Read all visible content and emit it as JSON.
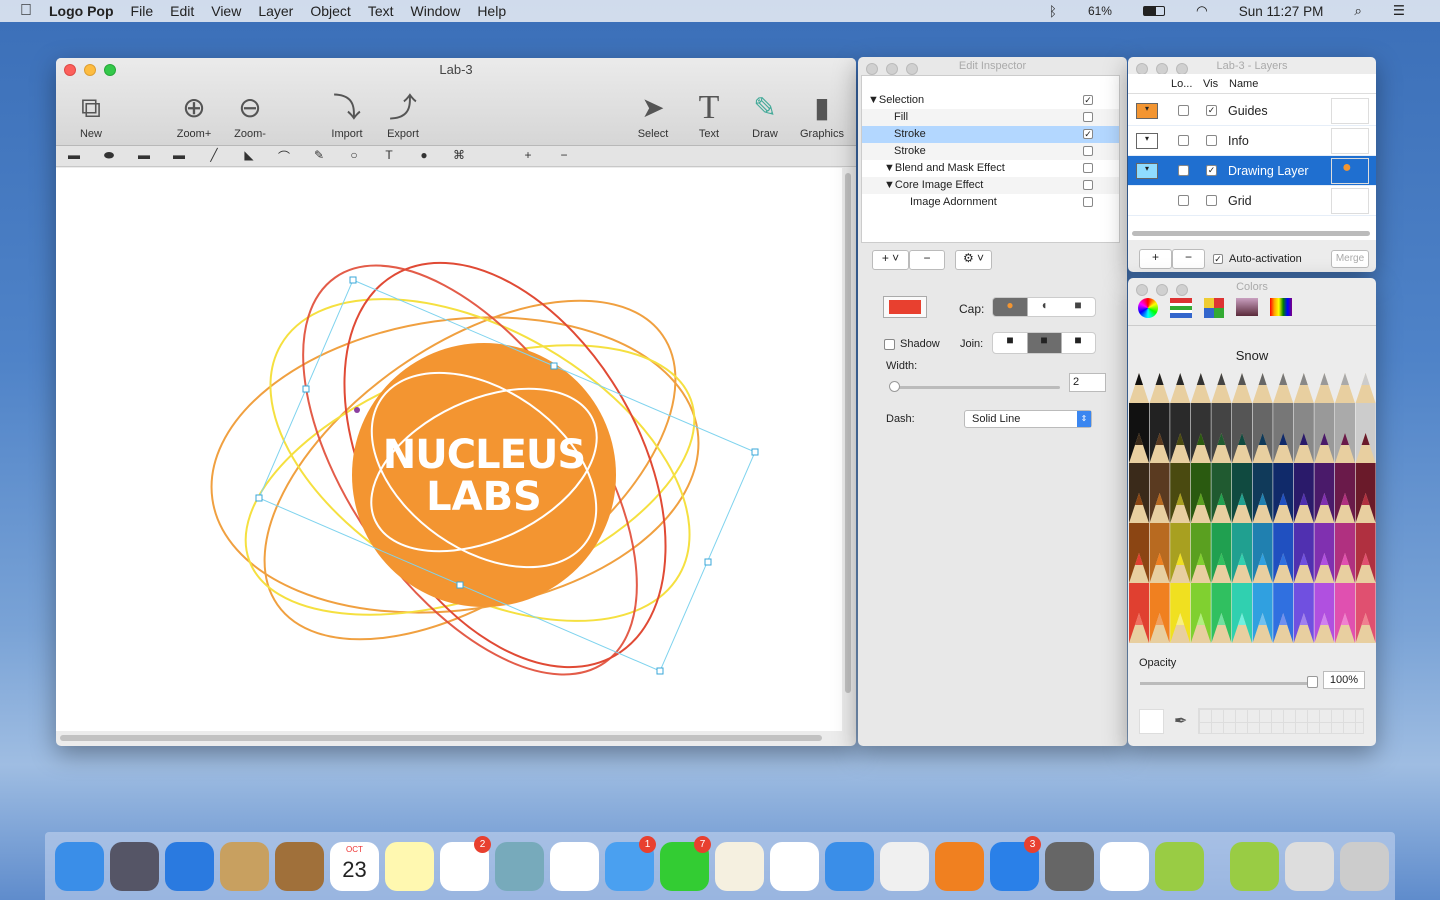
{
  "menubar": {
    "app": "Logo Pop",
    "items": [
      "File",
      "Edit",
      "View",
      "Layer",
      "Object",
      "Text",
      "Window",
      "Help"
    ],
    "battery": "61%",
    "clock": "Sun 11:27 PM"
  },
  "main_window": {
    "title": "Lab-3",
    "toolbar": {
      "new": "New",
      "zoom_in": "Zoom+",
      "zoom_out": "Zoom-",
      "import": "Import",
      "export": "Export",
      "select": "Select",
      "text": "Text",
      "draw": "Draw",
      "graphics": "Graphics"
    },
    "shape_tools": [
      "rectangle-icon",
      "oval-icon",
      "rounded-rect-icon",
      "capsule-icon",
      "line-icon",
      "polygon-icon",
      "curve-icon",
      "pen-icon",
      "ring-icon",
      "text-tool-icon",
      "speech-bubble-icon",
      "bezier-icon",
      "add-point-icon",
      "remove-point-icon"
    ],
    "logo": {
      "line1": "NUCLEUS",
      "line2": "LABS",
      "fill": "#f39531"
    }
  },
  "inspector": {
    "title": "Edit Inspector",
    "tree": [
      {
        "label": "Selection",
        "checked": true,
        "level": 0,
        "expander": true
      },
      {
        "label": "Fill",
        "checked": false,
        "level": 1
      },
      {
        "label": "Stroke",
        "checked": true,
        "level": 1,
        "selected": true
      },
      {
        "label": "Stroke",
        "checked": false,
        "level": 1
      },
      {
        "label": "Blend and Mask Effect",
        "checked": false,
        "level": 0.5,
        "expander": true
      },
      {
        "label": "Core Image Effect",
        "checked": false,
        "level": 0.5,
        "expander": true
      },
      {
        "label": "Image Adornment",
        "checked": false,
        "level": 2
      }
    ],
    "add": "+",
    "remove": "−",
    "stroke_color": "#e8402f",
    "cap_label": "Cap:",
    "join_label": "Join:",
    "shadow_label": "Shadow",
    "width_label": "Width:",
    "width_value": "2",
    "dash_label": "Dash:",
    "dash_value": "Solid Line"
  },
  "layers": {
    "title": "Lab-3 - Layers",
    "columns": [
      "Lo...",
      "Vis",
      "Name"
    ],
    "rows": [
      {
        "name": "Guides",
        "color": "#f39531",
        "locked": false,
        "visible": true
      },
      {
        "name": "Info",
        "color": "#ffffff",
        "locked": false,
        "visible": false
      },
      {
        "name": "Drawing Layer",
        "color": "#8fdcff",
        "locked": false,
        "visible": true,
        "selected": true
      },
      {
        "name": "Grid",
        "color": "",
        "locked": false,
        "visible": false
      }
    ],
    "add": "+",
    "remove": "−",
    "auto_activation": "Auto-activation",
    "auto_checked": true,
    "merge": "Merge"
  },
  "colors": {
    "title": "Colors",
    "color_name": "Snow",
    "opacity_label": "Opacity",
    "opacity_value": "100%"
  },
  "dock": {
    "items": [
      "Finder",
      "Launchpad",
      "Safari",
      "Mail",
      "Contacts",
      "Calendar",
      "Notes",
      "Reminders",
      "Maps",
      "Photos",
      "Messages",
      "FaceTime",
      "Pages",
      "Numbers",
      "Keynote",
      "iTunes",
      "iBooks",
      "App Store",
      "System Preferences",
      "TextEdit",
      "Logo Pop",
      "Logo Pop Document",
      "Preview",
      "Trash"
    ],
    "badges": {
      "Reminders": "2",
      "Messages": "1",
      "FaceTime": "7",
      "App Store": "3"
    },
    "calendar_month": "OCT",
    "calendar_day": "23"
  }
}
